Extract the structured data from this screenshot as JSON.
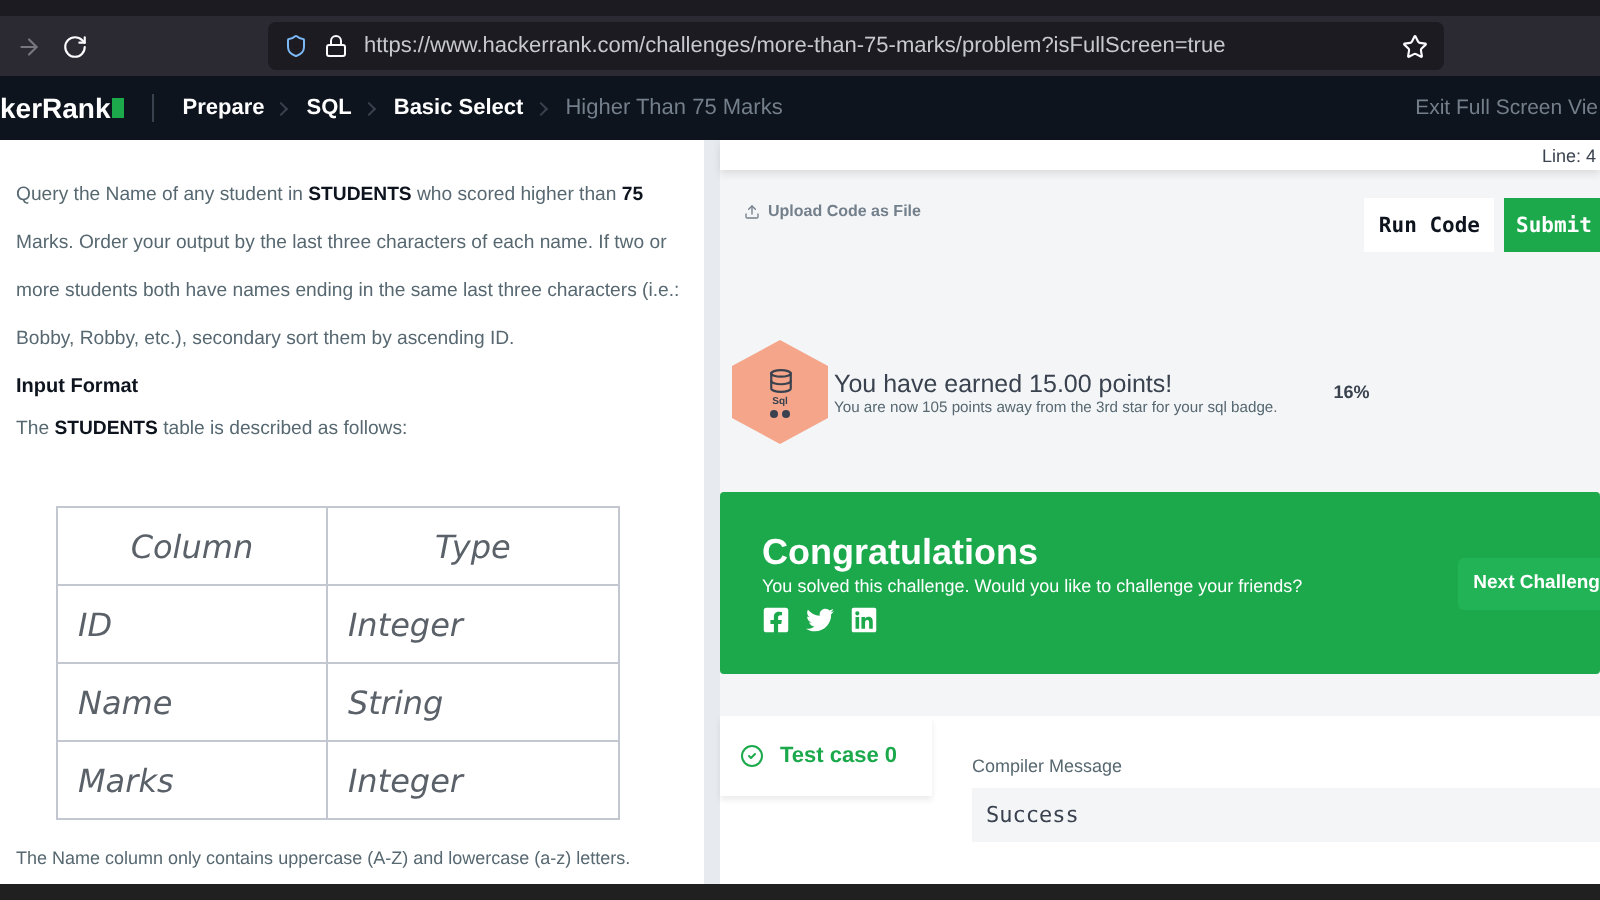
{
  "browser": {
    "url": "https://www.hackerrank.com/challenges/more-than-75-marks/problem?isFullScreen=true"
  },
  "navbar": {
    "logo": "kerRank",
    "breadcrumbs": [
      {
        "label": "Prepare",
        "current": false
      },
      {
        "label": "SQL",
        "current": false
      },
      {
        "label": "Basic Select",
        "current": false
      },
      {
        "label": "Higher Than 75 Marks",
        "current": true
      }
    ],
    "exit": "Exit Full Screen Vie"
  },
  "problem": {
    "statement": "Query the Name of any student in **STUDENTS** who scored higher than **75** Marks. Order your output by the last three characters of each name. If two or more students both have names ending in the same last three characters (i.e.: Bobby, Robby, etc.), secondary sort them by ascending ID.",
    "input_heading": "Input Format",
    "table_intro": "The **STUDENTS** table is described as follows:",
    "table": {
      "columns": [
        "Column",
        "Type"
      ],
      "rows": [
        [
          "ID",
          "Integer"
        ],
        [
          "Name",
          "String"
        ],
        [
          "Marks",
          "Integer"
        ]
      ]
    },
    "footer_text": "The Name column only contains uppercase (A-Z) and lowercase (a-z) letters."
  },
  "editor": {
    "line_indicator": "Line: 4",
    "upload": "Upload Code as File",
    "run_button": "Run Code",
    "submit_button": "Submit"
  },
  "badge": {
    "label": "Sql",
    "title": "You have earned 15.00 points!",
    "subtitle": "You are now 105 points away from the 3rd star for your sql badge.",
    "percent": "16%"
  },
  "congrats": {
    "title": "Congratulations",
    "message": "You solved this challenge. Would you like to challenge your friends?",
    "next_button": "Next Challeng"
  },
  "results": {
    "test_cases": [
      {
        "label": "Test case 0",
        "passed": true,
        "selected": true
      }
    ],
    "compiler_label": "Compiler Message",
    "compiler_output": "Success"
  }
}
